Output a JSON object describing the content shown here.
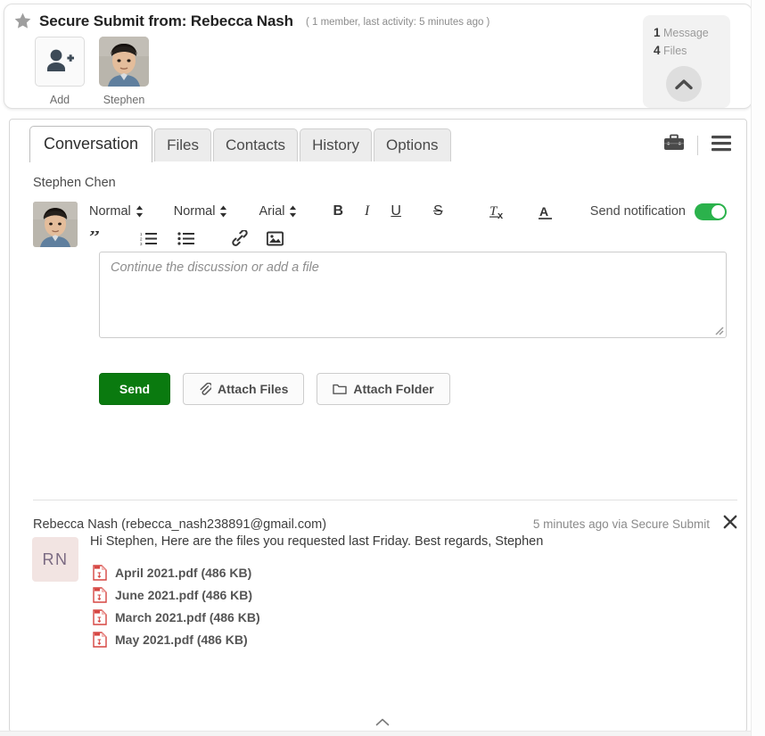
{
  "header": {
    "star_icon": "star-icon",
    "title": "Secure Submit from: Rebecca Nash",
    "meta": "( 1 member, last activity: 5 minutes ago )",
    "members": [
      {
        "label": "Add",
        "type": "add-person-icon"
      },
      {
        "label": "Stephen",
        "type": "photo-avatar"
      }
    ],
    "stats": {
      "messages_count": "1",
      "messages_label": "Message",
      "files_count": "4",
      "files_label": "Files",
      "collapse_icon": "chevron-up-icon"
    }
  },
  "tabs": [
    {
      "label": "Conversation",
      "active": true
    },
    {
      "label": "Files",
      "active": false
    },
    {
      "label": "Contacts",
      "active": false
    },
    {
      "label": "History",
      "active": false
    },
    {
      "label": "Options",
      "active": false
    }
  ],
  "header_icons": [
    {
      "name": "briefcase-icon"
    },
    {
      "name": "hamburger-menu-icon"
    }
  ],
  "composer": {
    "author": "Stephen Chen",
    "avatar": "stephen-avatar",
    "toolbar": {
      "style_select": "Normal",
      "size_select": "Normal",
      "font_select": "Arial",
      "bold": "B",
      "italic": "I",
      "underline": "U",
      "strikethrough": "S",
      "clear_format": "clear-formatting-icon",
      "text_color": "text-color-icon",
      "quote": "blockquote-icon",
      "ordered_list": "ordered-list-icon",
      "bullet_list": "bullet-list-icon",
      "link": "link-icon",
      "image": "image-icon",
      "notification_label": "Send notification",
      "notification_on": true
    },
    "placeholder": "Continue the discussion or add a file",
    "value": "",
    "buttons": {
      "send": "Send",
      "attach_files": "Attach Files",
      "attach_folder": "Attach Folder"
    }
  },
  "message": {
    "from": "Rebecca Nash (rebecca_nash238891@gmail.com)",
    "timestamp": "5 minutes ago via Secure Submit",
    "close_icon": "close-icon",
    "avatar_initials": "RN",
    "text": "Hi Stephen, Here are the files you requested last Friday. Best regards, Stephen",
    "files": [
      {
        "name": "April 2021.pdf (486 KB)",
        "icon": "pdf-file-icon"
      },
      {
        "name": "June 2021.pdf (486 KB)",
        "icon": "pdf-file-icon"
      },
      {
        "name": "March 2021.pdf (486 KB)",
        "icon": "pdf-file-icon"
      },
      {
        "name": "May 2021.pdf (486 KB)",
        "icon": "pdf-file-icon"
      }
    ]
  },
  "footer": {
    "collapse_icon": "chevron-up-small-icon"
  },
  "colors": {
    "send_button_green": "#0a7a0f",
    "toggle_green": "#2bb24c",
    "pdf_red": "#d64541",
    "avatar_bg": "#f2e4e2",
    "card_border": "#d6d6d6"
  }
}
